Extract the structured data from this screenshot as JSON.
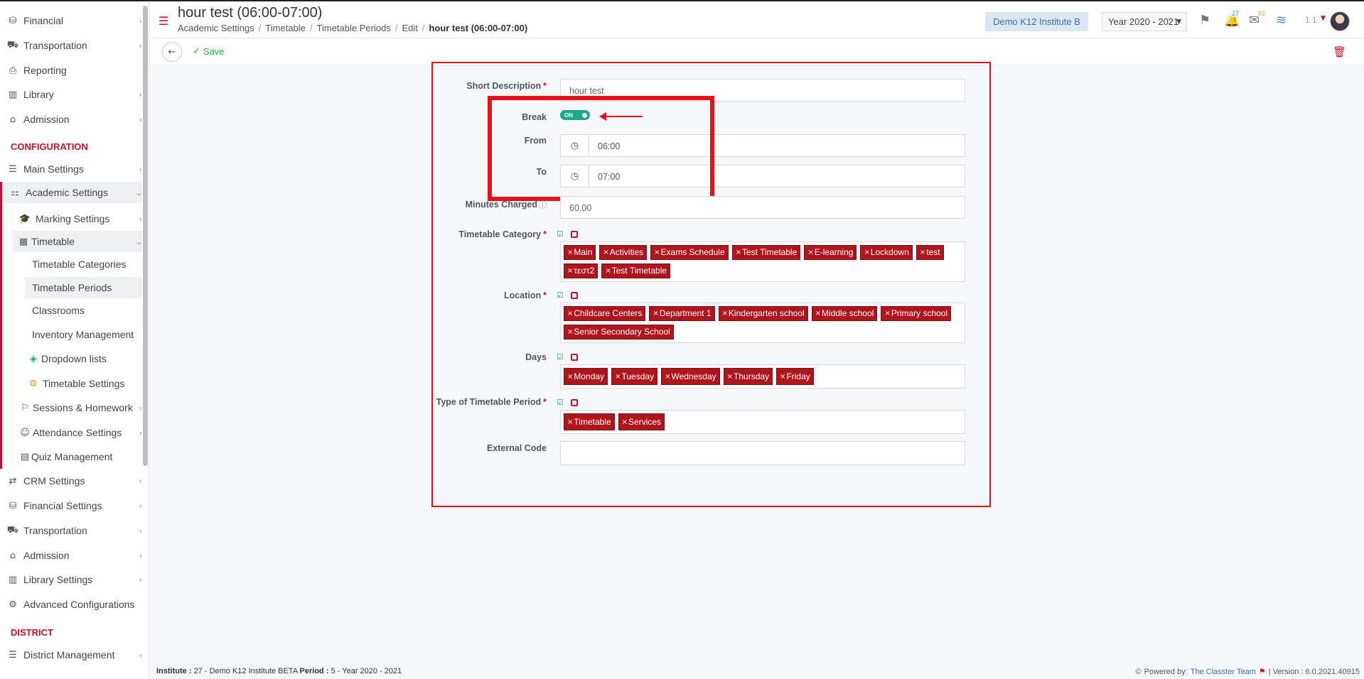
{
  "sidebar": {
    "top_items": [
      {
        "icon": "coins-icon",
        "glyph": "⛁",
        "label": "Financial"
      },
      {
        "icon": "bus-icon",
        "glyph": "⛟",
        "label": "Transportation"
      },
      {
        "icon": "printer-icon",
        "glyph": "⎙",
        "label": "Reporting"
      },
      {
        "icon": "books-icon",
        "glyph": "▥",
        "label": "Library"
      },
      {
        "icon": "institution-icon",
        "glyph": "⌂",
        "label": "Admission"
      }
    ],
    "section_configuration": "CONFIGURATION",
    "main_settings": "Main Settings",
    "academic_settings": "Academic Settings",
    "marking_settings": "Marking Settings",
    "timetable": "Timetable",
    "timetable_children": [
      "Timetable Categories",
      "Timetable Periods",
      "Classrooms",
      "Inventory Management",
      "Dropdown lists",
      "Timetable Settings"
    ],
    "sessions_homework": "Sessions & Homework",
    "attendance_settings": "Attendance Settings",
    "quiz_management": "Quiz Management",
    "lower_items": [
      {
        "icon": "shuffle-icon",
        "glyph": "⇄",
        "label": "CRM Settings"
      },
      {
        "icon": "coins-icon",
        "glyph": "⛁",
        "label": "Financial Settings"
      },
      {
        "icon": "bus-icon",
        "glyph": "⛟",
        "label": "Transportation"
      },
      {
        "icon": "institution-icon",
        "glyph": "⌂",
        "label": "Admission"
      },
      {
        "icon": "books-icon",
        "glyph": "▥",
        "label": "Library Settings"
      },
      {
        "icon": "gears-icon",
        "glyph": "⚙",
        "label": "Advanced Configurations"
      }
    ],
    "section_district": "DISTRICT",
    "district_management": "District Management"
  },
  "header": {
    "title": "hour test (06:00-07:00)",
    "breadcrumb": [
      "Academic Settings",
      "Timetable",
      "Timetable Periods",
      "Edit"
    ],
    "breadcrumb_current": "hour test (06:00-07:00)",
    "institute_button": "Demo K12 Institute B",
    "year_select": "Year 2020 - 2021",
    "notifications_count": "27",
    "messages_count": "82",
    "user_number": "1 1"
  },
  "toolbar": {
    "save_label": "Save"
  },
  "form": {
    "short_description_label": "Short Description",
    "short_description_value": "hour test",
    "break_label": "Break",
    "break_toggle": "ON",
    "from_label": "From",
    "from_value": "06:00",
    "to_label": "To",
    "to_value": "07:00",
    "minutes_charged_label": "Minutes Charged",
    "minutes_charged_value": "60.00",
    "timetable_category_label": "Timetable Category",
    "timetable_categories": [
      "Main",
      "Activities",
      "Exams Schedule",
      "Test Timetable",
      "E-learning",
      "Lockdown",
      "test",
      "τεστ2",
      "Test Timetable"
    ],
    "location_label": "Location",
    "locations": [
      "Childcare Centers",
      "Department 1",
      "Kindergarten school",
      "Middle school",
      "Primary school",
      "Senior Secondary School"
    ],
    "days_label": "Days",
    "days": [
      "Monday",
      "Tuesday",
      "Wednesday",
      "Thursday",
      "Friday"
    ],
    "type_label": "Type of Timetable Period",
    "types": [
      "Timetable",
      "Services"
    ],
    "external_code_label": "External Code",
    "external_code_value": ""
  },
  "footer": {
    "institute_label": "Institute :",
    "institute_value": "27 - Demo K12 Institute BETA",
    "period_label": "Period :",
    "period_value": "5 - Year 2020 - 2021",
    "powered_by": "Powered by:",
    "powered_link": "The Classter Team",
    "version": "| Version : 6.0.2021.40915"
  },
  "colors": {
    "brand_red": "#c8102e",
    "annotation_red": "#e8101a",
    "toggle_green": "#1aa78c",
    "tag_red": "#b0141d"
  }
}
